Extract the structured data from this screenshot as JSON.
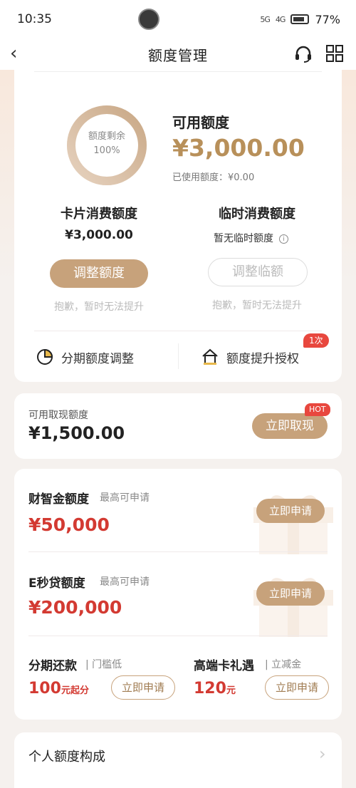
{
  "status": {
    "time": "10:35",
    "battery": "77%",
    "signal1": "5G",
    "signal2": "4G"
  },
  "nav": {
    "back": "‹",
    "title": "额度管理"
  },
  "summary": {
    "ring_label": "额度剩余",
    "ring_percent": "100%",
    "ring_fraction": 1.0,
    "available_title": "可用额度",
    "available_amount": "¥3,000.00",
    "used_text": "已使用额度：¥0.00"
  },
  "card_quota": {
    "title": "卡片消费额度",
    "amount": "¥3,000.00",
    "button": "调整额度",
    "note": "抱歉，暂时无法提升"
  },
  "temp_quota": {
    "title": "临时消费额度",
    "status": "暂无临时额度",
    "button": "调整临额",
    "note": "抱歉，暂时无法提升"
  },
  "entries": {
    "installment": "分期额度调整",
    "raise_auth": "额度提升授权",
    "raise_badge": "1次"
  },
  "cash": {
    "label": "可用取现额度",
    "amount": "¥1,500.00",
    "button": "立即取现",
    "badge": "HOT"
  },
  "loans": [
    {
      "title": "财智金额度",
      "hint": "最高可申请",
      "amount": "¥50,000",
      "button": "立即申请"
    },
    {
      "title": "E秒贷额度",
      "hint": "最高可申请",
      "amount": "¥200,000",
      "button": "立即申请"
    }
  ],
  "promos": [
    {
      "title": "分期还款",
      "sub": "门槛低",
      "value": "100",
      "unit": "元起分",
      "button": "立即申请"
    },
    {
      "title": "高端卡礼遇",
      "sub": "立减金",
      "value": "120",
      "unit": "元",
      "button": "立即申请"
    }
  ],
  "personal": {
    "label": "个人额度构成",
    "chevron": "›"
  },
  "colors": {
    "gold": "#c7a27b",
    "gold_text": "#b8905a",
    "red": "#d33a32",
    "badge_red": "#e8473e"
  }
}
